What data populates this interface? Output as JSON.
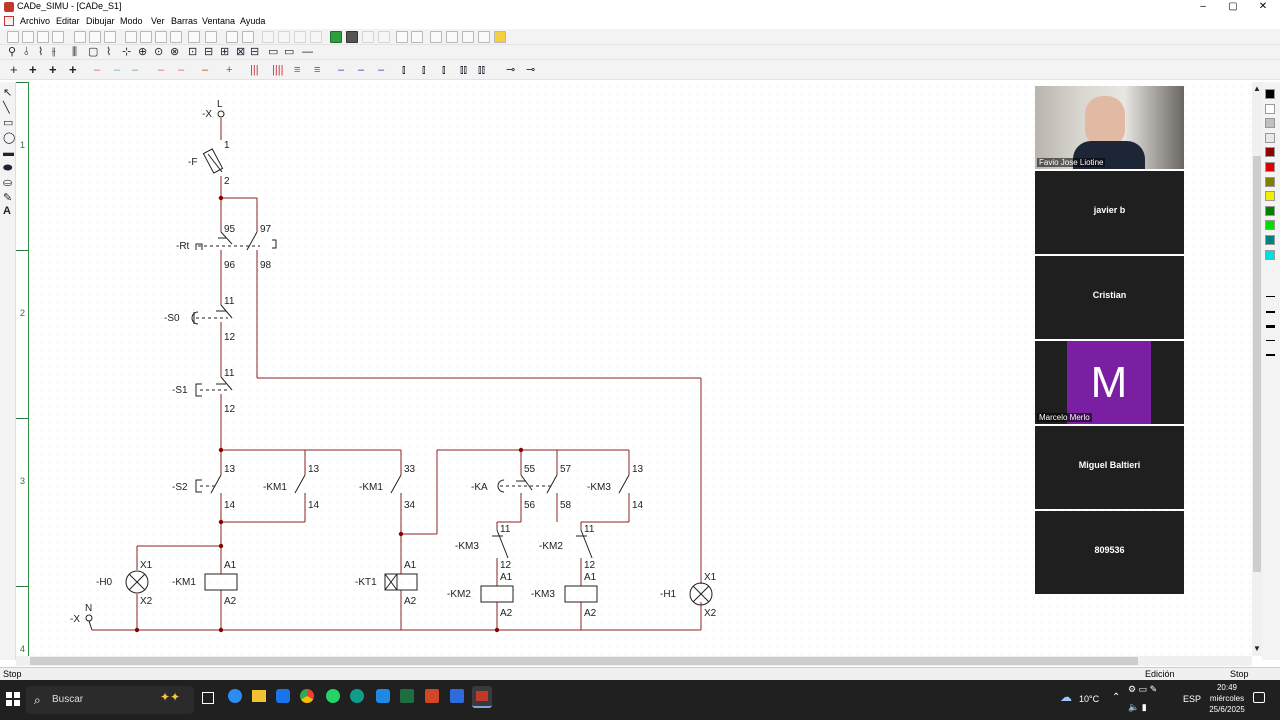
{
  "window": {
    "title": "CADe_SIMU - [CADe_S1]",
    "minimize": "–",
    "maximize": "▢",
    "close": "✕"
  },
  "menu": [
    "Archivo",
    "Editar",
    "Dibujar",
    "Modo",
    "Ver",
    "Barras",
    "Ventana",
    "Ayuda"
  ],
  "ruler": [
    "1",
    "2",
    "3",
    "4"
  ],
  "palette": [
    "#000000",
    "#ffffff",
    "#c0c0c0",
    "#e8e8e8",
    "#8b0000",
    "#e00000",
    "#808000",
    "#f0f000",
    "#008000",
    "#00e000",
    "#008080",
    "#00e0e0"
  ],
  "circuit": {
    "labels": {
      "x_l_tag": "-X",
      "x_l": "L",
      "f_tag": "-F",
      "f_1": "1",
      "f_2": "2",
      "rt_tag": "-Rt",
      "rt_95": "95",
      "rt_96": "96",
      "rt_97": "97",
      "rt_98": "98",
      "s0_tag": "-S0",
      "s0_11": "11",
      "s0_12": "12",
      "s1_tag": "-S1",
      "s1_11": "11",
      "s1_12": "12",
      "s2_tag": "-S2",
      "s2_13": "13",
      "s2_14": "14",
      "km1a_tag": "-KM1",
      "km1a_13": "13",
      "km1a_14": "14",
      "km1b_tag": "-KM1",
      "km1b_33": "33",
      "km1b_34": "34",
      "ka_tag": "-KA",
      "ka_55": "55",
      "ka_56": "56",
      "ka_57": "57",
      "ka_58": "58",
      "km3a_tag": "-KM3",
      "km3a_13": "13",
      "km3a_14": "14",
      "km3b_tag": "-KM3",
      "km3b_11": "11",
      "km3b_12": "12",
      "km2b_tag": "-KM2",
      "km2b_11": "11",
      "km2b_12": "12",
      "h0_tag": "-H0",
      "h0_x1": "X1",
      "h0_x2": "X2",
      "km1c_tag": "-KM1",
      "km1c_a1": "A1",
      "km1c_a2": "A2",
      "kt1_tag": "-KT1",
      "kt1_a1": "A1",
      "kt1_a2": "A2",
      "km2c_tag": "-KM2",
      "km2c_a1": "A1",
      "km2c_a2": "A2",
      "km3c_tag": "-KM3",
      "km3c_a1": "A1",
      "km3c_a2": "A2",
      "h1_tag": "-H1",
      "h1_x1": "X1",
      "h1_x2": "X2",
      "x_n_tag": "-X",
      "x_n": "N"
    }
  },
  "participants": [
    {
      "name": "Favio Jose Liotine",
      "type": "video"
    },
    {
      "name": "javier b",
      "type": "name"
    },
    {
      "name": "Cristian",
      "type": "name"
    },
    {
      "name": "Marcelo Merlo",
      "type": "avatar",
      "initial": "M",
      "color": "#7b1fa2"
    },
    {
      "name": "Miguel Baltieri",
      "type": "name"
    },
    {
      "name": "809536",
      "type": "name"
    }
  ],
  "status": {
    "left": "Stop",
    "mode": "Edición",
    "right": "Stop"
  },
  "taskbar": {
    "search_placeholder": "Buscar",
    "weather": "10°C",
    "lang": "ESP",
    "time": "20:49",
    "day": "miércoles",
    "date": "25/6/2025"
  }
}
